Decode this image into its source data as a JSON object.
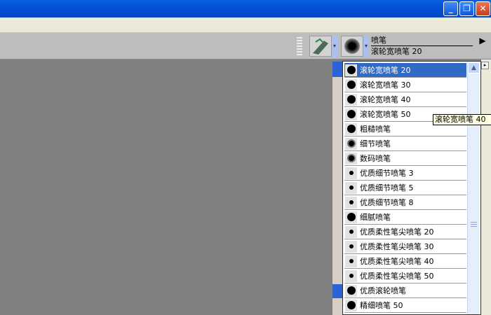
{
  "window": {
    "minimize": "_",
    "restore": "❐",
    "close": "✕"
  },
  "toolbar": {
    "category": "喷笔",
    "variant": "滚轮宽喷笔 20",
    "more": "▶",
    "dropdown": "▾"
  },
  "list": {
    "scroll_up": "▲",
    "side_button": "▸",
    "items": [
      {
        "label": "滚轮宽喷笔 20",
        "icon": "big",
        "selected": true
      },
      {
        "label": "滚轮宽喷笔 30",
        "icon": "big"
      },
      {
        "label": "滚轮宽喷笔 40",
        "icon": "big"
      },
      {
        "label": "滚轮宽喷笔 50",
        "icon": "big"
      },
      {
        "label": "粗糙喷笔",
        "icon": "big"
      },
      {
        "label": "细节喷笔",
        "icon": "mid"
      },
      {
        "label": "数码喷笔",
        "icon": "mid"
      },
      {
        "label": "优质细节喷笔 3",
        "icon": "small"
      },
      {
        "label": "优质细节喷笔 5",
        "icon": "small"
      },
      {
        "label": "优质细节喷笔 8",
        "icon": "small"
      },
      {
        "label": "细腻喷笔",
        "icon": "big"
      },
      {
        "label": "优质柔性笔尖喷笔 20",
        "icon": "small"
      },
      {
        "label": "优质柔性笔尖喷笔 30",
        "icon": "small"
      },
      {
        "label": "优质柔性笔尖喷笔 40",
        "icon": "small"
      },
      {
        "label": "优质柔性笔尖喷笔 50",
        "icon": "small"
      },
      {
        "label": "优质滚轮喷笔",
        "icon": "big"
      },
      {
        "label": "精细喷笔 50",
        "icon": "big"
      }
    ]
  },
  "tooltip": "滚轮宽喷笔 40"
}
